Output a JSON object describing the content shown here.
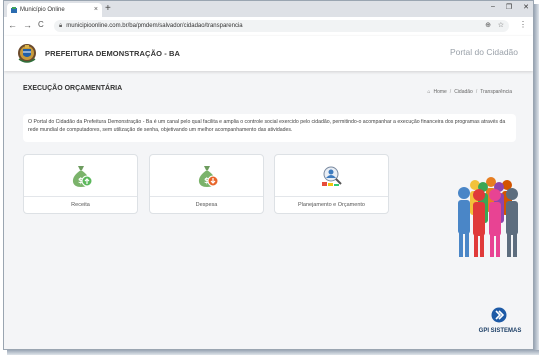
{
  "browser": {
    "tab_title": "Município Online",
    "tab_close": "×",
    "new_tab": "+",
    "window_controls": [
      "–",
      "❐",
      "✕"
    ],
    "nav": {
      "back": "←",
      "forward": "→",
      "reload": "C"
    },
    "url": "municipioonline.com.br/ba/pmdem/salvador/cidadao/transparencia",
    "zoom_glyph": "⊕",
    "star_glyph": "☆",
    "menu_glyph": "⋮"
  },
  "site": {
    "name": "PREFEITURA DEMONSTRAÇÃO - BA",
    "portal": "Portal do Cidadão"
  },
  "page": {
    "title": "EXECUÇÃO ORÇAMENTÁRIA",
    "breadcrumb": {
      "home_icon": "⌂",
      "home": "Home",
      "sep": "/",
      "items": [
        "Cidadão",
        "Transparência"
      ]
    },
    "description": "O Portal do Cidadão da Prefeitura Demonstração - Ba é um canal pelo qual facilita e amplia o controle social exercido pelo cidadão, permitindo-o acompanhar a execução financeira dos programas através da rede mundial de computadores, sem utilização de senha, objetivando um melhor acompanhamento das atividades."
  },
  "cards": [
    {
      "label": "Receita",
      "icon": "money-bag-up-icon"
    },
    {
      "label": "Despesa",
      "icon": "money-bag-down-icon"
    },
    {
      "label": "Planejamento e Orçamento",
      "icon": "planning-icon"
    }
  ],
  "footer": {
    "brand": "GPI SISTEMAS"
  },
  "colors": {
    "accent": "#2f7bbf",
    "green": "#5cb85c",
    "orange": "#e8662b",
    "money": "#7bb36b"
  }
}
